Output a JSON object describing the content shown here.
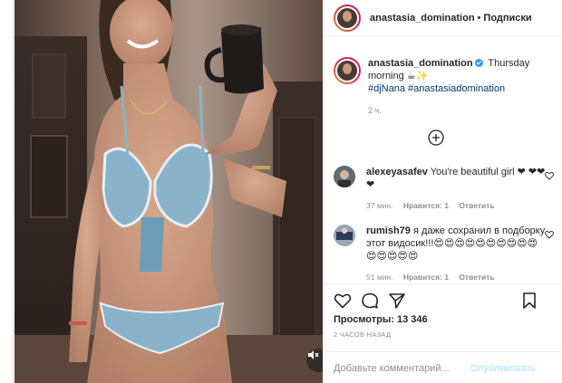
{
  "header": {
    "username": "anastasia_domination",
    "separator": "•",
    "follow_label": "Подписки"
  },
  "caption": {
    "username": "anastasia_domination",
    "text": "Thursday morning ☕✨",
    "hashtags": [
      "#djNana",
      "#anastasiadomination"
    ],
    "time": "2 ч."
  },
  "comments": [
    {
      "username": "alexeyasafev",
      "text": "You're beautiful girl ❤ ❤❤❤",
      "time": "37 мин.",
      "likes": "Нравится: 1",
      "reply": "Ответить"
    },
    {
      "username": "rumish79",
      "text": "я даже сохранил в подборку этот видосик!!!😍😍😍😍😍😍😍😍😍😍😍😍😍😍😍",
      "time": "51 мин.",
      "likes": "Нравится: 1",
      "reply": "Ответить"
    }
  ],
  "stats": {
    "views_label": "Просмотры:",
    "views_value": "13 346",
    "posted": "2 ЧАСОВ НАЗАД"
  },
  "comment_box": {
    "placeholder": "Добавьте комментарий...",
    "publish_label": "Опубликовать"
  },
  "icons": [
    "heart-icon",
    "comment-icon",
    "share-icon",
    "bookmark-icon",
    "plus-circle-icon",
    "mute-icon",
    "verified-icon"
  ],
  "colors": {
    "link": "#00376b",
    "muted": "#8e8e8e",
    "publish_disabled": "#b2dffc",
    "verified": "#3897f0"
  }
}
